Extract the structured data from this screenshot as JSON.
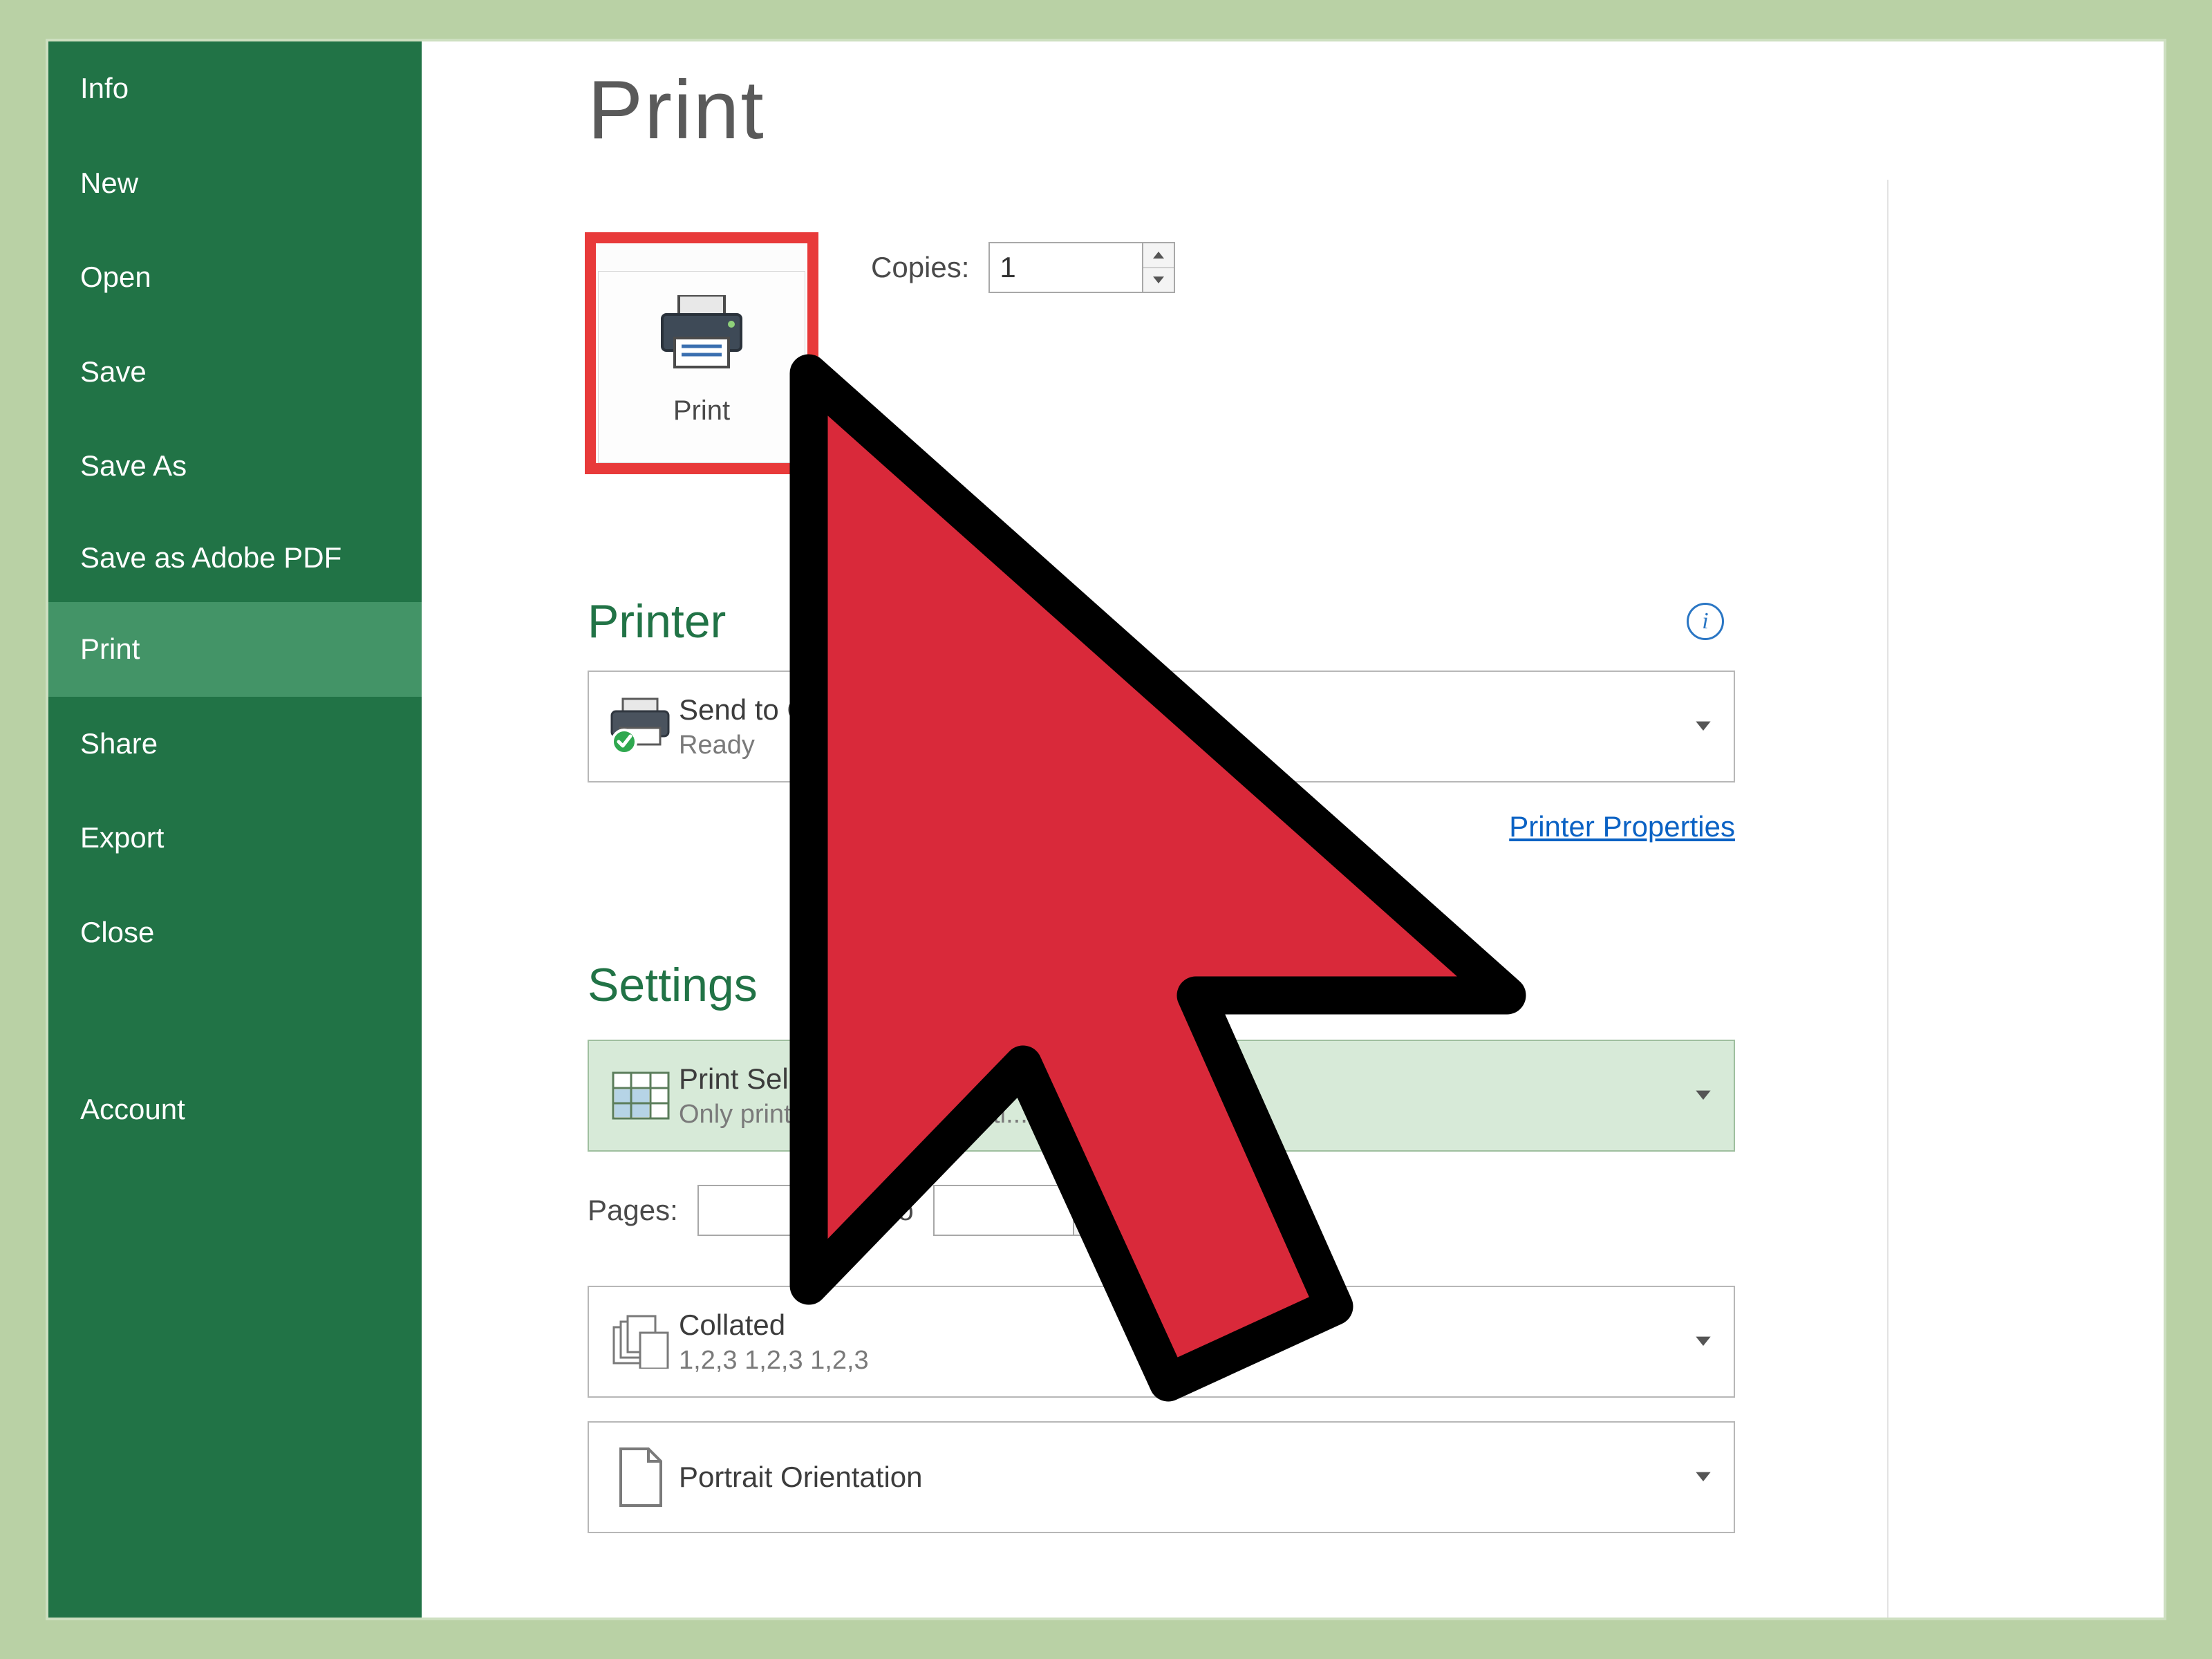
{
  "frame": {
    "bg": "#b9d1a5"
  },
  "sidebar": {
    "items": [
      {
        "label": "Info",
        "active": false
      },
      {
        "label": "New",
        "active": false
      },
      {
        "label": "Open",
        "active": false
      },
      {
        "label": "Save",
        "active": false
      },
      {
        "label": "Save As",
        "active": false
      },
      {
        "label": "Save as Adobe PDF",
        "active": false
      },
      {
        "label": "Print",
        "active": true
      },
      {
        "label": "Share",
        "active": false
      },
      {
        "label": "Export",
        "active": false
      },
      {
        "label": "Close",
        "active": false
      }
    ],
    "footer": {
      "label": "Account"
    }
  },
  "page": {
    "title": "Print",
    "print_button_label": "Print",
    "copies_label": "Copies:",
    "copies_value": "1"
  },
  "printer": {
    "section_title": "Printer",
    "info_badge": "i",
    "name": "Send to OneNote 2013",
    "status": "Ready",
    "properties_link": "Printer Properties"
  },
  "settings": {
    "section_title": "Settings",
    "print_what": {
      "line1": "Print Selection",
      "line2": "Only print the current selecti..."
    },
    "pages": {
      "label": "Pages:",
      "from": "",
      "to_label": "to",
      "to": ""
    },
    "collate": {
      "line1": "Collated",
      "line2": "1,2,3    1,2,3    1,2,3"
    },
    "orientation": {
      "line1": "Portrait Orientation"
    }
  },
  "icons": {
    "printer": "printer-icon",
    "chevron": "chevron-down-icon",
    "spinner_up": "spinner-up-icon",
    "spinner_down": "spinner-down-icon",
    "grid": "grid-icon",
    "collate": "collate-icon",
    "page": "page-icon",
    "info": "info-icon",
    "cursor": "cursor-pointer-icon"
  },
  "colors": {
    "accent": "#217346",
    "accent_hover": "#439467",
    "highlight": "#e83a3a",
    "link": "#0b62c4"
  }
}
